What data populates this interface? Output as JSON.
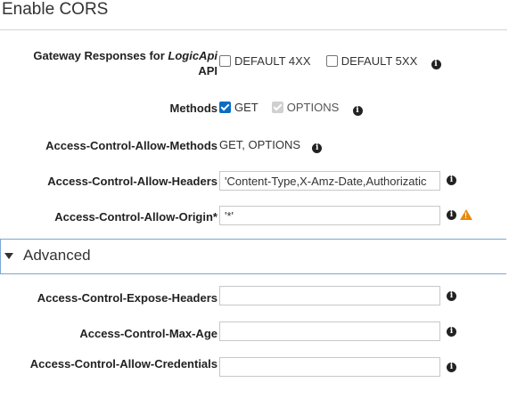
{
  "title": "Enable CORS",
  "gateway": {
    "label_prefix": "Gateway Responses for ",
    "api_name": "LogicApi",
    "label_suffix": "API",
    "option_4xx": "DEFAULT 4XX",
    "option_5xx": "DEFAULT 5XX",
    "checked_4xx": false,
    "checked_5xx": false
  },
  "methods": {
    "label": "Methods",
    "get": "GET",
    "options": "OPTIONS",
    "get_checked": true,
    "options_checked": true
  },
  "allow_methods": {
    "label": "Access-Control-Allow-Methods",
    "value": "GET, OPTIONS"
  },
  "allow_headers": {
    "label": "Access-Control-Allow-Headers",
    "value": "'Content-Type,X-Amz-Date,Authorizatic"
  },
  "allow_origin": {
    "label": "Access-Control-Allow-Origin*",
    "value": "'*'"
  },
  "advanced": {
    "label": "Advanced"
  },
  "expose_headers": {
    "label": "Access-Control-Expose-Headers",
    "value": ""
  },
  "max_age": {
    "label": "Access-Control-Max-Age",
    "value": ""
  },
  "allow_credentials": {
    "label": "Access-Control-Allow-Credentials",
    "value": ""
  },
  "icons": {
    "info": "info-icon",
    "warning": "warning-icon"
  },
  "colors": {
    "checkbox_checked": "#0b6cc4",
    "warning": "#e8890c",
    "advanced_border": "#7aa7d6"
  }
}
